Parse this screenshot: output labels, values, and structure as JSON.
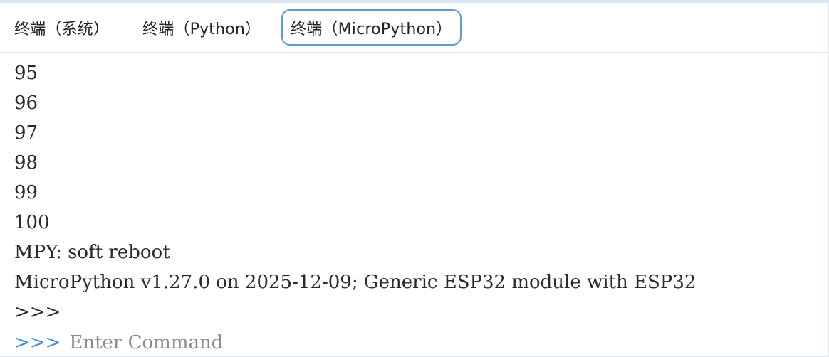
{
  "tabs": [
    {
      "label": "终端（系统）",
      "active": false
    },
    {
      "label": "终端（Python）",
      "active": false
    },
    {
      "label": "终端（MicroPython）",
      "active": true
    }
  ],
  "terminal": {
    "lines": [
      "95",
      "96",
      "97",
      "98",
      "99",
      "100",
      "MPY: soft reboot",
      "MicroPython v1.27.0 on 2025-12-09; Generic ESP32 module with ESP32",
      ">>>"
    ],
    "input_prompt": ">>>",
    "input_placeholder": "Enter Command",
    "input_value": ""
  },
  "colors": {
    "active_tab_border": "#5b9bd5",
    "prompt": "#3b8ed8",
    "text": "#2a2a2a",
    "placeholder": "#8a8a8a"
  }
}
